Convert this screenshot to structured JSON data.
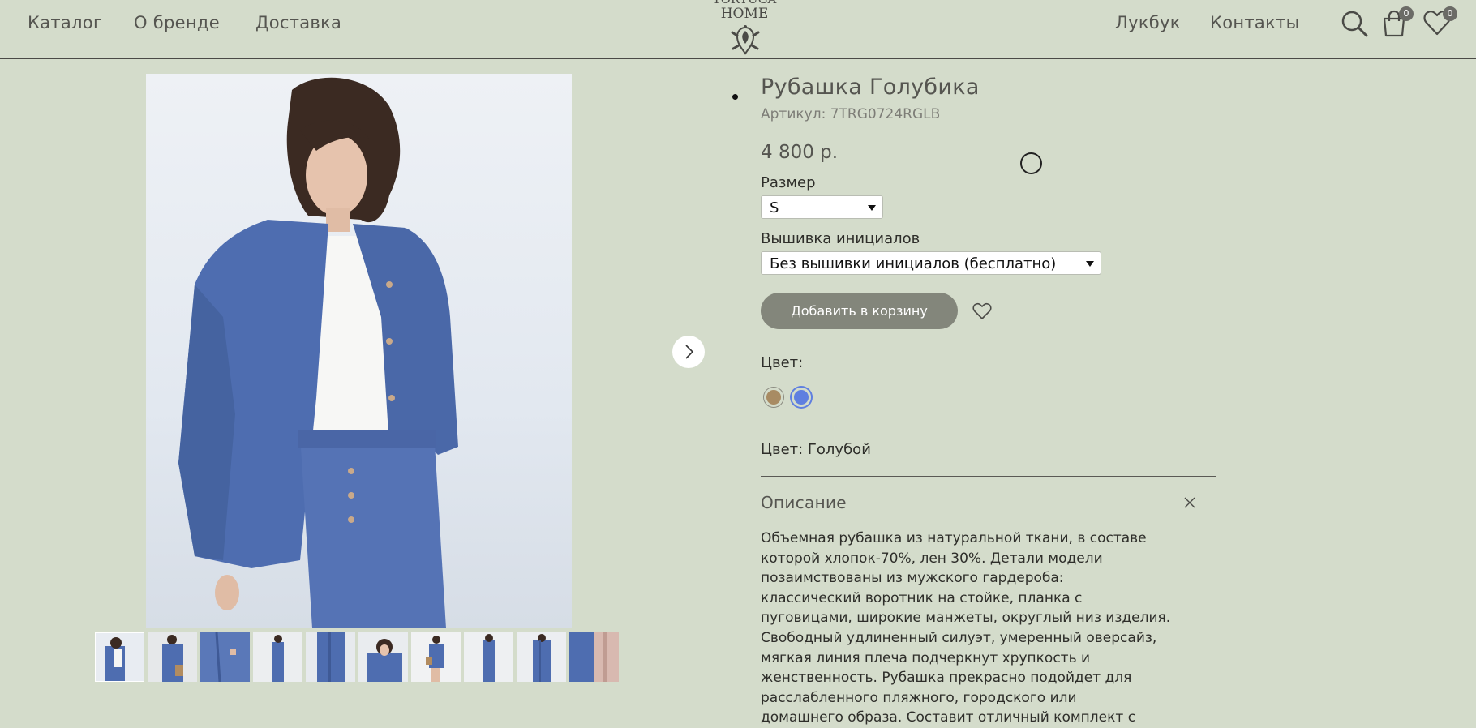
{
  "header": {
    "nav": [
      "Каталог",
      "О бренде",
      "Доставка"
    ],
    "logo_line1": "TORTUGA",
    "logo_line2": "HOME",
    "nav_right": [
      "Лукбук",
      "Контакты"
    ],
    "cart_count": "0",
    "wishlist_count": "0",
    "icons": [
      "search-icon",
      "cart-icon",
      "wishlist-heart-icon"
    ]
  },
  "product": {
    "title": "Рубашка Голубика",
    "sku": "Артикул: 7TRG0724RGLB",
    "price": "4 800 р.",
    "size_label": "Размер",
    "size_value": "S",
    "embroidery_label": "Вышивка инициалов",
    "embroidery_value": "Без вышивки инициалов (бесплатно)",
    "add_to_cart": "Добавить в корзину",
    "color_label": "Цвет:",
    "colors": [
      "#a88b63",
      "#5f7fe0"
    ],
    "selected_color_text": "Цвет: Голубой",
    "description_title": "Описание",
    "description_lines": [
      "Объемная рубашка из натуральной ткани, в составе",
      "которой хлопок-70%, лен 30%. Детали модели",
      "позаимствованы из мужского гардероба:",
      "классический воротник на стойке, планка с",
      "пуговицами, широкие манжеты, округлый низ изделия.",
      "Свободный удлиненный силуэт, умеренный оверсайз,",
      "мягкая линия плеча подчеркнут хрупкость и",
      "женственность. Рубашка прекрасно подойдет для",
      "расслабленного пляжного, городского или",
      "домашнего образа. Составит отличный комплект с"
    ]
  },
  "gallery": {
    "thumbnail_count": 10
  }
}
